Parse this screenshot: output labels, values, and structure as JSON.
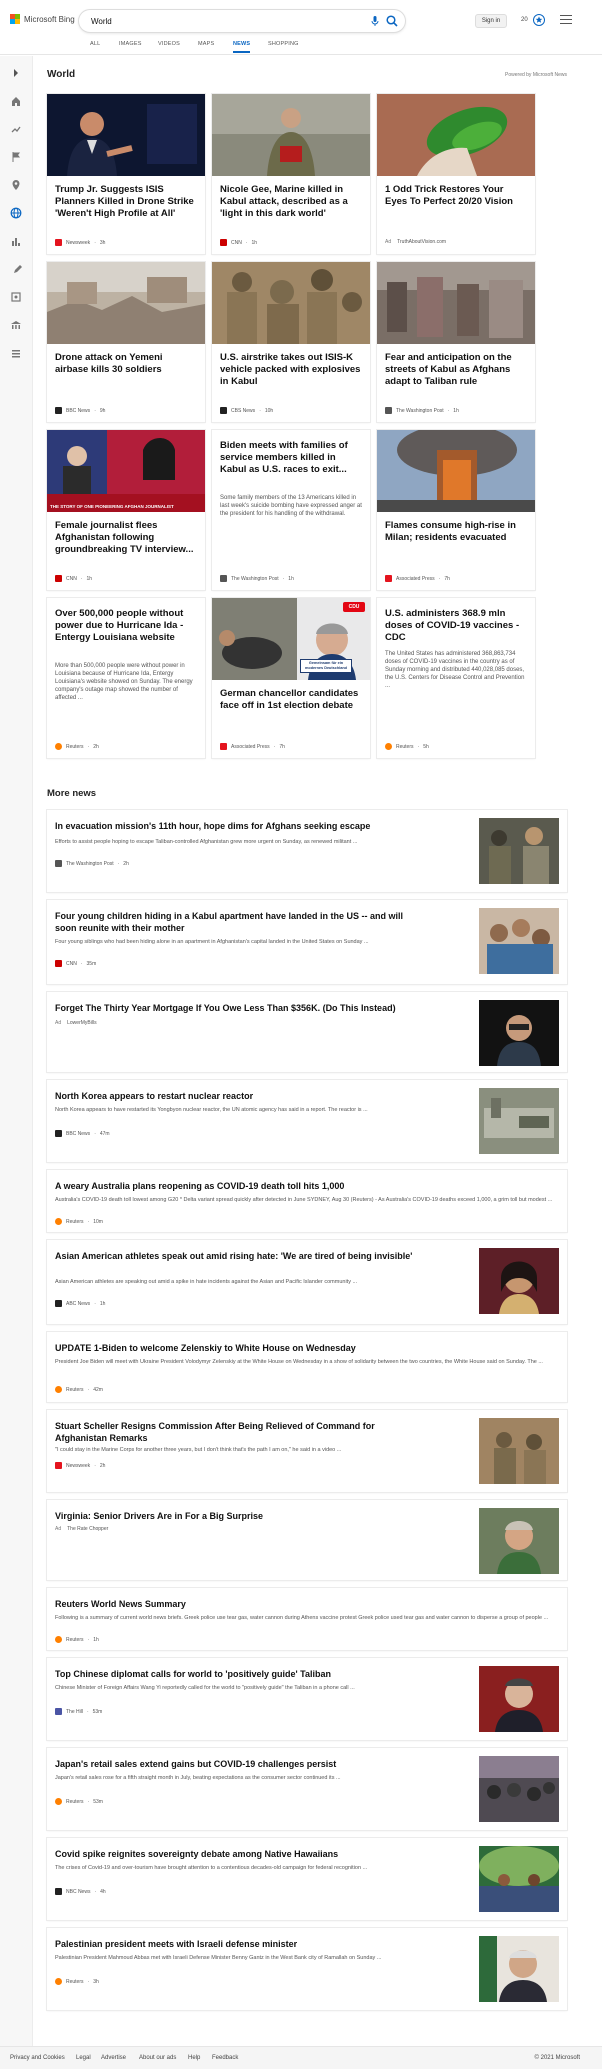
{
  "brand": {
    "name": "Microsoft Bing",
    "colors": [
      "#f25022",
      "#7fba00",
      "#00a4ef",
      "#ffb900"
    ]
  },
  "search": {
    "value": "World",
    "mic_icon": "microphone-icon",
    "search_icon": "search-icon"
  },
  "header": {
    "signin": "Sign in",
    "points": "20"
  },
  "tabs": [
    "ALL",
    "IMAGES",
    "VIDEOS",
    "MAPS",
    "NEWS",
    "SHOPPING"
  ],
  "active_tab": "NEWS",
  "section": {
    "title": "World",
    "powered": "Powered by Microsoft News"
  },
  "cards": [
    {
      "title": "Trump Jr. Suggests ISIS Planners Killed in Drone Strike 'Weren't High Profile at All'",
      "desc": "",
      "source": "Newsweek",
      "time": "3h",
      "logo_color": "#e4141e",
      "ad": ""
    },
    {
      "title": "Nicole Gee, Marine killed in Kabul attack, described as a 'light in this dark world'",
      "desc": "",
      "source": "CNN",
      "time": "1h",
      "logo_color": "#cc0000",
      "ad": ""
    },
    {
      "title": "1 Odd Trick Restores Your Eyes To Perfect 20/20 Vision",
      "desc": "",
      "source": "TruthAboutVision.com",
      "time": "",
      "logo_color": "",
      "ad": "Ad"
    },
    {
      "title": "Drone attack on Yemeni airbase kills 30 soldiers",
      "desc": "",
      "source": "BBC News",
      "time": "9h",
      "logo_color": "#222222",
      "ad": ""
    },
    {
      "title": "U.S. airstrike takes out ISIS-K vehicle packed with explosives in Kabul",
      "desc": "",
      "source": "CBS News",
      "time": "10h",
      "logo_color": "#222222",
      "ad": ""
    },
    {
      "title": "Fear and anticipation on the streets of Kabul as Afghans adapt to Taliban rule",
      "desc": "",
      "source": "The Washington Post",
      "time": "1h",
      "logo_color": "#555555",
      "ad": ""
    },
    {
      "title": "Female journalist flees Afghanistan following groundbreaking TV interview...",
      "desc": "",
      "source": "CNN",
      "time": "1h",
      "logo_color": "#cc0000",
      "ad": ""
    },
    {
      "title": "Biden meets with families of service members killed in Kabul as U.S. races to exit...",
      "desc": "Some family members of the 13 Americans killed in last week's suicide bombing have expressed anger at the president for his handling of the withdrawal.",
      "source": "The Washington Post",
      "time": "1h",
      "logo_color": "#555555",
      "ad": ""
    },
    {
      "title": "Flames consume high-rise in Milan; residents evacuated",
      "desc": "",
      "source": "Associated Press",
      "time": "7h",
      "logo_color": "#e4141e",
      "ad": ""
    },
    {
      "title": "Over 500,000 people without power due to Hurricane Ida - Entergy Louisiana website",
      "desc": "More than 500,000 people were without power in Louisiana because of Hurricane Ida, Entergy Louisiana's website showed on Sunday. The energy company's outage map showed the number of affected ...",
      "source": "Reuters",
      "time": "2h",
      "logo_color": "#ff8000",
      "ad": ""
    },
    {
      "title": "German chancellor candidates face off in 1st election debate",
      "desc": "",
      "source": "Associated Press",
      "time": "7h",
      "logo_color": "#e4141e",
      "ad": ""
    },
    {
      "title": "U.S. administers 368.9 mln doses of COVID-19 vaccines - CDC",
      "desc": "The United States has administered 368,863,734 doses of COVID-19 vaccines in the country as of Sunday morning and distributed 440,028,085 doses, the U.S. Centers for Disease Control and Prevention ...",
      "source": "Reuters",
      "time": "5h",
      "logo_color": "#ff8000",
      "ad": ""
    }
  ],
  "card_images": {
    "cnn_caption": "THE STORY OF ONE PIONEERING AFGHAN JOURNALIST",
    "cdu_logo": "CDU",
    "cdu_banner": "Gemeinsam für ein modernes Deutschland"
  },
  "more_news_title": "More news",
  "more_news": [
    {
      "title": "In evacuation mission's 11th hour, hope dims for Afghans seeking escape",
      "desc": "Efforts to assist people hoping to escape Taliban-controlled Afghanistan grew more urgent on Sunday, as renewed militant ...",
      "source": "The Washington Post",
      "time": "2h",
      "ad": "",
      "logo_color": "#555555"
    },
    {
      "title": "Four young children hiding in a Kabul apartment have landed in the US -- and will soon reunite with their mother",
      "desc": "Four young siblings who had been hiding alone in an apartment in Afghanistan's capital landed in the United States on Sunday ...",
      "source": "CNN",
      "time": "35m",
      "ad": "",
      "logo_color": "#cc0000"
    },
    {
      "title": "Forget The Thirty Year Mortgage If You Owe Less Than $356K. (Do This Instead)",
      "desc": "",
      "source": "LowerMyBills",
      "time": "",
      "ad": "Ad",
      "logo_color": ""
    },
    {
      "title": "North Korea appears to restart nuclear reactor",
      "desc": "North Korea appears to have restarted its Yongbyon nuclear reactor, the UN atomic agency has said in a report. The reactor is ...",
      "source": "BBC News",
      "time": "47m",
      "ad": "",
      "logo_color": "#222222"
    },
    {
      "title": "A weary Australia plans reopening as COVID-19 death toll hits 1,000",
      "desc": "Australia's COVID-19 death toll lowest among G20 * Delta variant spread quickly after detected in June SYDNEY, Aug 30 (Reuters) - As Australia's COVID-19 deaths exceed 1,000, a grim toll but modest ...",
      "source": "Reuters",
      "time": "10m",
      "ad": "",
      "logo_color": "#ff8000"
    },
    {
      "title": "Asian American athletes speak out amid rising hate: 'We are tired of being invisible'",
      "desc": "Asian American athletes are speaking out amid a spike in hate incidents against the Asian and Pacific Islander community ...",
      "source": "ABC News",
      "time": "1h",
      "ad": "",
      "logo_color": "#222222"
    },
    {
      "title": "UPDATE 1-Biden to welcome Zelenskiy to White House on Wednesday",
      "desc": "President Joe Biden will meet with Ukraine President Volodymyr Zelenskiy at the White House on Wednesday in a show of solidarity between the two countries, the White House said on Sunday. The ...",
      "source": "Reuters",
      "time": "42m",
      "ad": "",
      "logo_color": "#ff8000"
    },
    {
      "title": "Stuart Scheller Resigns Commission After Being Relieved of Command for Afghanistan Remarks",
      "desc": "\"I could stay in the Marine Corps for another three years, but I don't think that's the path I am on,\" he said in a video ...",
      "source": "Newsweek",
      "time": "2h",
      "ad": "",
      "logo_color": "#e4141e"
    },
    {
      "title": "Virginia: Senior Drivers Are in For a Big Surprise",
      "desc": "",
      "source": "The Rate Chopper",
      "time": "",
      "ad": "Ad",
      "logo_color": ""
    },
    {
      "title": "Reuters World News Summary",
      "desc": "Following is a summary of current world news briefs. Greek police use tear gas, water cannon during Athens vaccine protest Greek police used tear gas and water cannon to disperse a group of people ...",
      "source": "Reuters",
      "time": "1h",
      "ad": "",
      "logo_color": "#ff8000"
    },
    {
      "title": "Top Chinese diplomat calls for world to 'positively guide' Taliban",
      "desc": "Chinese Minister of Foreign Affairs Wang Yi reportedly called for the world to \"positively guide\" the Taliban in a phone call ...",
      "source": "The Hill",
      "time": "53m",
      "ad": "",
      "logo_color": "#4b55a5"
    },
    {
      "title": "Japan's retail sales extend gains but COVID-19 challenges persist",
      "desc": "Japan's retail sales rose for a fifth straight month in July, beating expectations as the consumer sector continued its ...",
      "source": "Reuters",
      "time": "53m",
      "ad": "",
      "logo_color": "#ff8000"
    },
    {
      "title": "Covid spike reignites sovereignty debate among Native Hawaiians",
      "desc": "The crises of Covid-19 and over-tourism have brought attention to a contentious decades-old campaign for federal recognition ...",
      "source": "NBC News",
      "time": "4h",
      "ad": "",
      "logo_color": "#222222"
    },
    {
      "title": "Palestinian president meets with Israeli defense minister",
      "desc": "Palestinian President Mahmoud Abbas met with Israeli Defense Minister Benny Gantz in the West Bank city of Ramallah on Sunday ...",
      "source": "Reuters",
      "time": "3h",
      "ad": "",
      "logo_color": "#ff8000"
    }
  ],
  "footer": {
    "links": [
      "Privacy and Cookies",
      "Legal",
      "Advertise",
      "About our ads",
      "Help",
      "Feedback"
    ],
    "copyright": "© 2021 Microsoft"
  }
}
